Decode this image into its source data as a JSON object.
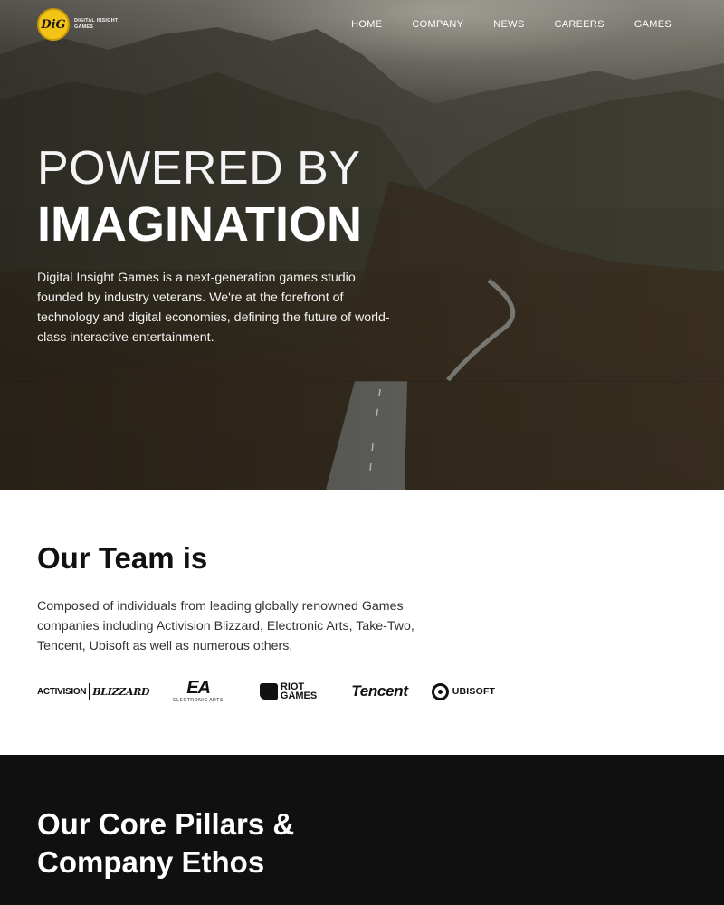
{
  "nav": {
    "logo_mark": "DiG",
    "logo_text": "Digital Insight Games",
    "items": [
      "HOME",
      "COMPANY",
      "NEWS",
      "CAREERS",
      "GAMES"
    ]
  },
  "hero": {
    "headline_light": "POWERED BY",
    "headline_bold": "IMAGINATION",
    "description": "Digital Insight Games is a next-generation games studio founded by industry veterans. We're at the forefront of technology and digital economies, defining the future of world-class interactive entertainment."
  },
  "team": {
    "heading": "Our Team is",
    "description": "Composed of individuals from leading globally renowned Games companies including Activision Blizzard, Electronic Arts, Take-Two, Tencent, Ubisoft as well as numerous others.",
    "logos": {
      "activision": "ACTIVISION",
      "blizzard": "BLIZZARD",
      "ea": "EA",
      "ea_sub": "ELECTRONIC ARTS",
      "riot_top": "RIOT",
      "riot_bottom": "GAMES",
      "tencent": "Tencent",
      "ubisoft": "UBISOFT"
    }
  },
  "pillars": {
    "heading": "Our Core Pillars & Company Ethos"
  },
  "colors": {
    "logo_accent": "#f3c316",
    "dark_section": "#101010"
  }
}
